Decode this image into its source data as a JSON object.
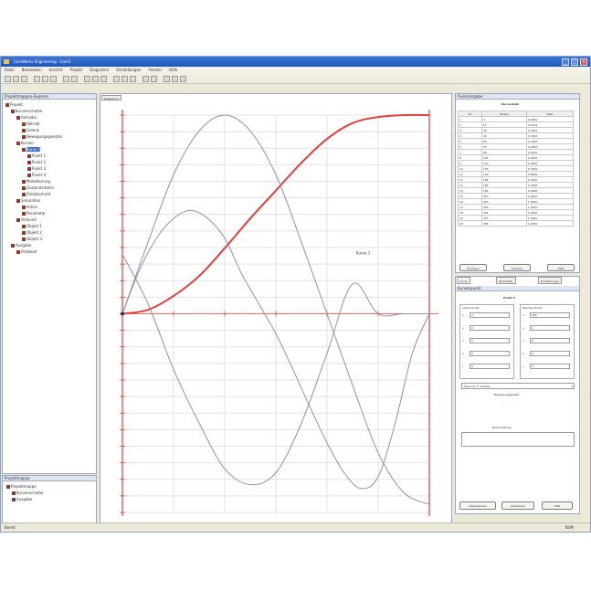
{
  "window": {
    "title": "CamWorks Engineering - Cam1"
  },
  "menu": [
    "Datei",
    "Bearbeiten",
    "Ansicht",
    "Projekt",
    "Diagramm",
    "Einstellungen",
    "Fenster",
    "Hilfe"
  ],
  "left_panel": {
    "title": "Projektmappen-Explorer",
    "tree": [
      {
        "label": "Projekt",
        "level": 0
      },
      {
        "label": "Kurvenscheibe",
        "level": 1
      },
      {
        "label": "Antriebe",
        "level": 2
      },
      {
        "label": "Abtrieb",
        "level": 3
      },
      {
        "label": "Gelenk",
        "level": 3
      },
      {
        "label": "Bewegungsgesetze",
        "level": 3
      },
      {
        "label": "Kurven",
        "level": 2
      },
      {
        "label": "Kurve 1",
        "level": 3,
        "selected": true
      },
      {
        "label": "Punkt 1",
        "level": 4
      },
      {
        "label": "Punkt 2",
        "level": 4
      },
      {
        "label": "Punkt 3",
        "level": 4
      },
      {
        "label": "Punkt 4",
        "level": 4
      },
      {
        "label": "Modellierung",
        "level": 3
      },
      {
        "label": "Zustandsdaten",
        "level": 3
      },
      {
        "label": "Zeitabschnitt",
        "level": 3
      },
      {
        "label": "Simulation",
        "level": 2
      },
      {
        "label": "Achse",
        "level": 3
      },
      {
        "label": "Parameter",
        "level": 3
      },
      {
        "label": "Verbund",
        "level": 2
      },
      {
        "label": "Objekt 1",
        "level": 3
      },
      {
        "label": "Objekt 2",
        "level": 3
      },
      {
        "label": "Objekt 3",
        "level": 3
      },
      {
        "label": "Ausgabe",
        "level": 1
      },
      {
        "label": "Protokoll",
        "level": 2
      }
    ],
    "bottom_title": "Projektmappe",
    "bottom_items": [
      "Projektmappe",
      "Kurvenscheibe",
      "Ausgabe"
    ]
  },
  "chart_panel": {
    "tab": "Diagramm",
    "annotation": "Kurve 1"
  },
  "chart_data": {
    "type": "line",
    "title": "",
    "xlabel": "",
    "ylabel": "",
    "xlim": [
      0,
      360
    ],
    "ylim": [
      -1,
      1
    ],
    "grid": true,
    "series": [
      {
        "color": "#e0403c",
        "x": [
          0,
          30,
          60,
          90,
          120,
          150,
          180,
          210,
          240,
          270,
          300,
          330,
          360
        ],
        "y": [
          0,
          0.02,
          0.09,
          0.19,
          0.33,
          0.48,
          0.62,
          0.76,
          0.88,
          0.96,
          0.99,
          1.0,
          1.0
        ]
      },
      {
        "color": "#9090a8",
        "x": [
          0,
          30,
          60,
          90,
          120,
          150,
          180,
          210,
          240,
          270,
          300,
          330,
          360
        ],
        "y": [
          0,
          0.36,
          0.7,
          0.92,
          1.0,
          0.92,
          0.7,
          0.36,
          0,
          -0.36,
          -0.7,
          -0.9,
          -0.96
        ]
      },
      {
        "color": "#9090a8",
        "x": [
          0,
          20,
          40,
          60,
          80,
          100,
          120,
          140,
          160,
          180,
          200,
          220,
          240,
          260,
          280,
          300,
          320,
          340,
          360
        ],
        "y": [
          0,
          0.22,
          0.38,
          0.48,
          0.52,
          0.48,
          0.38,
          0.2,
          0.05,
          -0.1,
          -0.28,
          -0.47,
          -0.65,
          -0.8,
          -0.88,
          -0.82,
          -0.55,
          -0.2,
          0.0
        ]
      },
      {
        "color": "#9090a8",
        "x": [
          0,
          30,
          60,
          90,
          120,
          150,
          180,
          210,
          240,
          270,
          300,
          330,
          360
        ],
        "y": [
          0.3,
          0.05,
          -0.28,
          -0.55,
          -0.78,
          -0.86,
          -0.8,
          -0.55,
          -0.2,
          0.15,
          0.0,
          0.0,
          0.0
        ]
      }
    ]
  },
  "right_panel": {
    "top_title": "Punkteingabe",
    "table_title": "Kurvenliste",
    "columns": [
      "Nr",
      "Winkel",
      "Wert"
    ],
    "rows": [
      [
        "1",
        "0",
        "0.0000"
      ],
      [
        "2",
        "15",
        "0.0125"
      ],
      [
        "3",
        "30",
        "0.0492"
      ],
      [
        "4",
        "45",
        "0.1090"
      ],
      [
        "5",
        "60",
        "0.1900"
      ],
      [
        "6",
        "75",
        "0.2890"
      ],
      [
        "7",
        "90",
        "0.4020"
      ],
      [
        "8",
        "105",
        "0.5240"
      ],
      [
        "9",
        "120",
        "0.6460"
      ],
      [
        "10",
        "135",
        "0.7600"
      ],
      [
        "11",
        "150",
        "0.8580"
      ],
      [
        "12",
        "165",
        "0.9320"
      ],
      [
        "13",
        "180",
        "0.9780"
      ],
      [
        "14",
        "195",
        "0.9980"
      ],
      [
        "15",
        "210",
        "1.0000"
      ],
      [
        "16",
        "225",
        "1.0000"
      ],
      [
        "17",
        "240",
        "1.0000"
      ],
      [
        "18",
        "255",
        "1.0000"
      ],
      [
        "19",
        "270",
        "1.0000"
      ],
      [
        "20",
        "285",
        "1.0000"
      ]
    ],
    "table_buttons": [
      "Einfügen",
      "Löschen",
      "Hilfe"
    ],
    "tabs": [
      "Kurve",
      "Parameter",
      "Einstellungen"
    ],
    "section_title": "Kurvenpunkt",
    "form_header": "Punkt 3",
    "left_group": "Linker Punkt",
    "right_group": "Rechter Punkt",
    "field_labels": [
      "x",
      "y",
      "v",
      "a",
      "j"
    ],
    "left_values": [
      "0",
      "0",
      "0",
      "0",
      "0"
    ],
    "right_values": [
      "180",
      "1",
      "0",
      "0",
      "0"
    ],
    "dropdown": "Polynom 5. Grades",
    "note_label": "Bewegungsgesetz",
    "desc_label": "Beschreibung",
    "bottom_buttons": [
      "Übernehmen",
      "Abbrechen",
      "Hilfe"
    ]
  },
  "status": {
    "text": "Bereit",
    "right": "NUM"
  }
}
